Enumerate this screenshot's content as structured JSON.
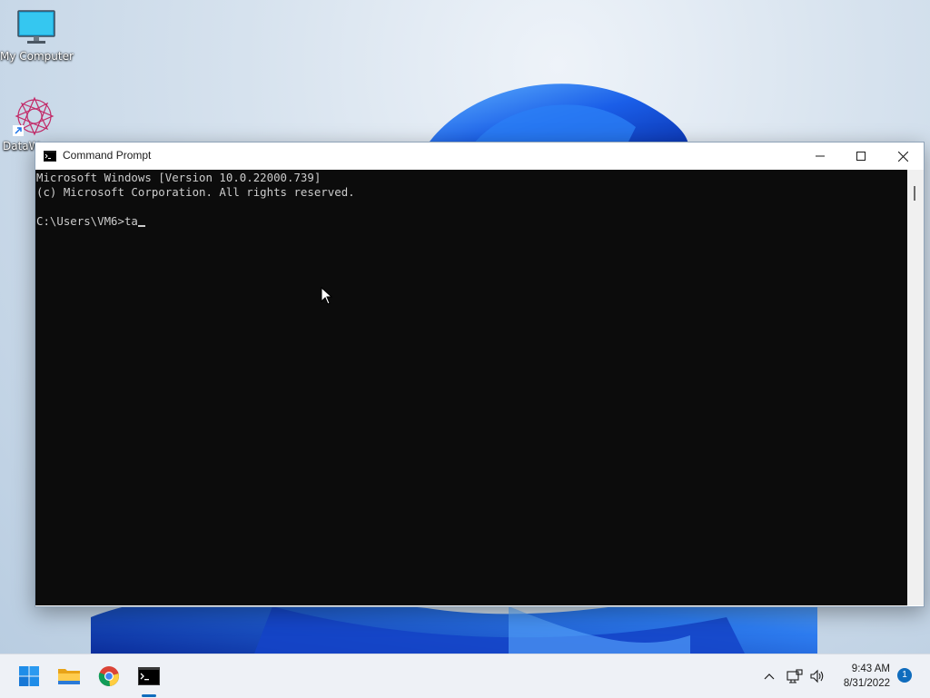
{
  "desktop": {
    "icons": [
      {
        "label": "My Computer",
        "icon": "monitor-icon"
      },
      {
        "label": "DataW",
        "icon": "datawatch-icon"
      }
    ]
  },
  "window": {
    "title": "Command Prompt",
    "icon": "cmd-icon",
    "controls": {
      "minimize": "minimize-icon",
      "maximize": "maximize-icon",
      "close": "close-icon"
    }
  },
  "console": {
    "lines": [
      "Microsoft Windows [Version 10.0.22000.739]",
      "(c) Microsoft Corporation. All rights reserved.",
      "",
      "C:\\Users\\VM6>ta"
    ],
    "colors": {
      "background": "#0c0c0c",
      "text": "#cccccc"
    }
  },
  "taskbar": {
    "pinned": [
      {
        "name": "Start",
        "icon": "windows-start-icon"
      },
      {
        "name": "File Explorer",
        "icon": "folder-icon"
      },
      {
        "name": "Google Chrome",
        "icon": "chrome-icon"
      },
      {
        "name": "Command Prompt",
        "icon": "cmd-icon",
        "active": true
      }
    ],
    "tray": {
      "icons": [
        "chevron-up-icon",
        "network-icon",
        "speaker-icon"
      ],
      "time": "9:43 AM",
      "date": "8/31/2022",
      "notification_count": "1"
    },
    "accent": "#0f6cbd"
  }
}
